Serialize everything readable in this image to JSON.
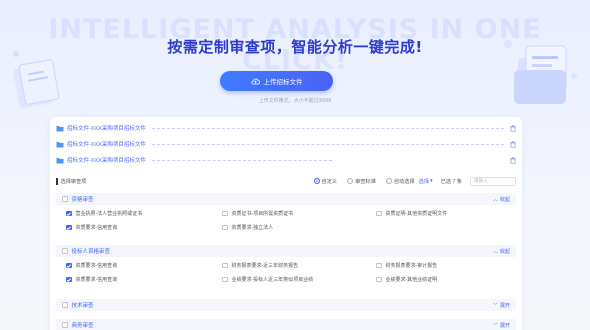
{
  "hero": {
    "watermark": "INTELLIGENT ANALYSIS IN ONE CLICK!",
    "title": "按需定制审查项，智能分析一键完成!",
    "upload_button": "上传招标文件",
    "upload_hint": "上传文件格式，大小不超过300M"
  },
  "files": [
    {
      "name": "招标文件-XXX采购项目招标文件",
      "icon": "folder-icon"
    },
    {
      "name": "招标文件-XXX采购项目招标文件",
      "icon": "folder-icon"
    },
    {
      "name": "招标文件-XXX采购项目招标文件",
      "icon": "folder-icon"
    }
  ],
  "toolbar": {
    "label": "选择审查项",
    "options": [
      "自定义",
      "审查标准",
      "自动选择"
    ],
    "selected": "自定义",
    "dropdown": "选择",
    "count_text": "已选 7 条",
    "search_placeholder": "请输入"
  },
  "sections": [
    {
      "title": "资格审查",
      "toggle": "收起",
      "items": [
        {
          "label": "营业执照-法人营业执照或证书",
          "checked": true
        },
        {
          "label": "资质证书-项目所需资质证书",
          "checked": false
        },
        {
          "label": "资质证明-其他资质证明文件",
          "checked": false
        },
        {
          "label": "资质要求-信用查询",
          "checked": true
        },
        {
          "label": "资质要求-独立法人",
          "checked": false
        }
      ]
    },
    {
      "title": "投标人资格审查",
      "toggle": "收起",
      "items": [
        {
          "label": "资质要求-信用查询",
          "checked": true
        },
        {
          "label": "财务报表要求-近三年财务报告",
          "checked": false
        },
        {
          "label": "财务报表要求-审计报告",
          "checked": false
        },
        {
          "label": "资质要求-信用查询",
          "checked": true
        },
        {
          "label": "业绩要求-投标人近三年类似项目业绩",
          "checked": false
        },
        {
          "label": "业绩要求-其他业绩证明",
          "checked": false
        }
      ]
    },
    {
      "title": "技术审查",
      "toggle": "展开",
      "items": []
    },
    {
      "title": "商务审查",
      "toggle": "展开",
      "items": []
    }
  ],
  "colors": {
    "accent": "#3d6af5",
    "title": "#2b3cd0"
  }
}
